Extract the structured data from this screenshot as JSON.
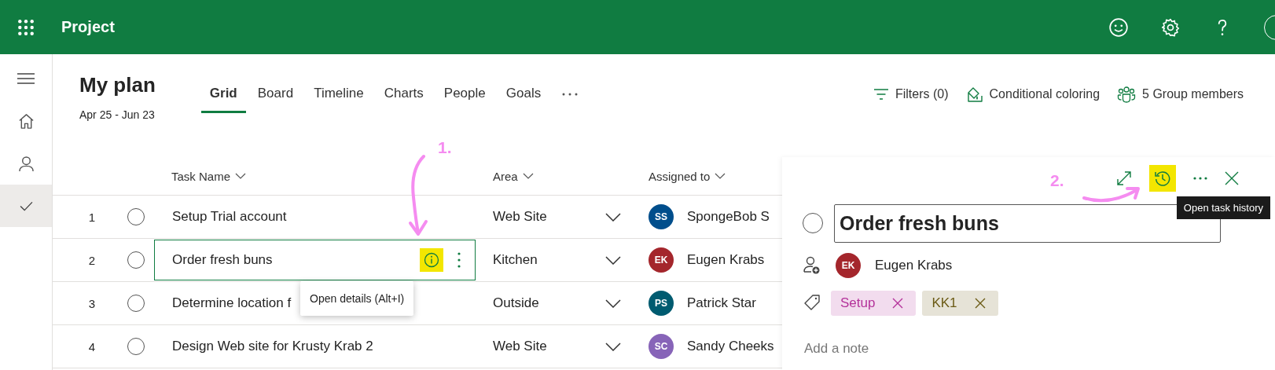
{
  "app_bar": {
    "title": "Project"
  },
  "nav_rail": [
    {
      "kind": "menu",
      "selected": false
    },
    {
      "kind": "home",
      "selected": false
    },
    {
      "kind": "person",
      "selected": false
    },
    {
      "kind": "tasks",
      "selected": true
    }
  ],
  "plan": {
    "title": "My plan",
    "dates": "Apr 25 - Jun 23"
  },
  "tabs": [
    {
      "label": "Grid",
      "selected": true
    },
    {
      "label": "Board",
      "selected": false
    },
    {
      "label": "Timeline",
      "selected": false
    },
    {
      "label": "Charts",
      "selected": false
    },
    {
      "label": "People",
      "selected": false
    },
    {
      "label": "Goals",
      "selected": false
    }
  ],
  "toolbar": [
    {
      "kind": "filter",
      "label": "Filters (0)"
    },
    {
      "kind": "coloring",
      "label": "Conditional coloring"
    },
    {
      "kind": "members",
      "label": "5 Group members"
    }
  ],
  "grid": {
    "columns": [
      "Task Name",
      "Area",
      "Assigned to"
    ],
    "rows": [
      {
        "number": "1",
        "completed": false,
        "task": "Setup Trial account",
        "area": "Web Site",
        "initials": "SS",
        "assignee": "SpongeBob S",
        "color": "#004e8c",
        "selected": false
      },
      {
        "number": "2",
        "completed": false,
        "task": "Order fresh buns",
        "area": "Kitchen",
        "initials": "EK",
        "assignee": "Eugen Krabs",
        "color": "#a4262c",
        "selected": true,
        "info_highlighted": true
      },
      {
        "number": "3",
        "completed": false,
        "task": "Determine location f",
        "area": "Outside",
        "initials": "PS",
        "assignee": "Patrick Star",
        "color": "#005b70",
        "selected": false
      },
      {
        "number": "4",
        "completed": false,
        "task": "Design Web site for Krusty Krab 2",
        "area": "Web Site",
        "initials": "SC",
        "assignee": "Sandy Cheeks",
        "color": "#8764b8",
        "selected": false
      }
    ]
  },
  "details_tooltip": "Open details (Alt+I)",
  "panel": {
    "history_highlighted": true,
    "history_tooltip": "Open task history",
    "completed": false,
    "title": "Order fresh buns",
    "assignee": {
      "initials": "EK",
      "name": "Eugen Krabs",
      "color": "#a4262c"
    },
    "labels": [
      {
        "text": "Setup",
        "color": "#b4329a"
      },
      {
        "text": "KK1",
        "color": "#6b5a14"
      }
    ],
    "note_placeholder": "Add a note"
  },
  "annotations": [
    {
      "text": "1."
    },
    {
      "text": "2."
    }
  ]
}
